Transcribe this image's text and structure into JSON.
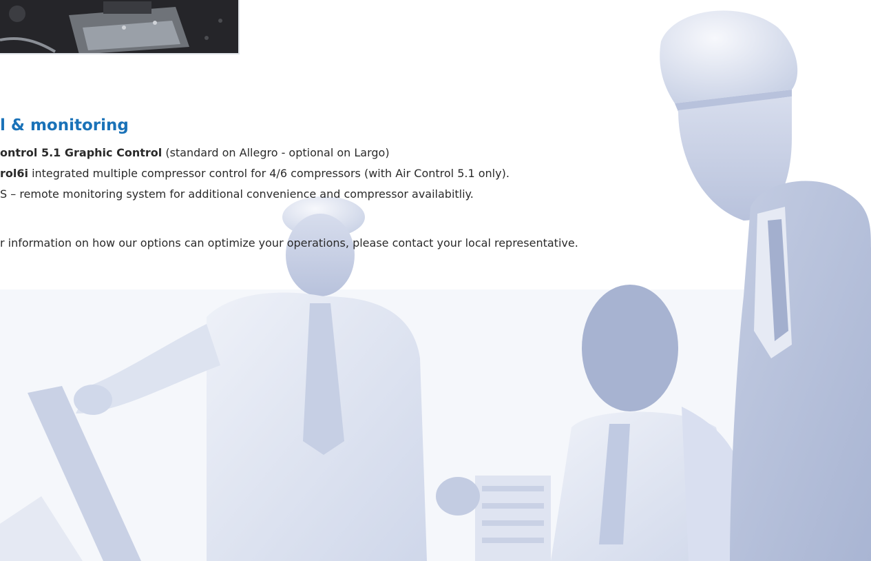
{
  "photo": {
    "name": "business-people-hardhats-photo"
  },
  "heading": "l & monitoring",
  "features": [
    {
      "bold": "ontrol 5.1 Graphic Control",
      "rest": " (standard on Allegro - optional on Largo)"
    },
    {
      "bold": "rol6i",
      "rest": " integrated multiple compressor control for 4/6 compressors (with Air Control 5.1 only)."
    },
    {
      "bold": "",
      "rest": "S – remote monitoring system for additional convenience and compressor availabitliy."
    }
  ],
  "contact": "r information on how our options can optimize your operations, please contact your local representative.",
  "colors": {
    "heading": "#1a72b8",
    "body_text": "#2a2a2a",
    "photo_tint": "#c9d3e8"
  }
}
